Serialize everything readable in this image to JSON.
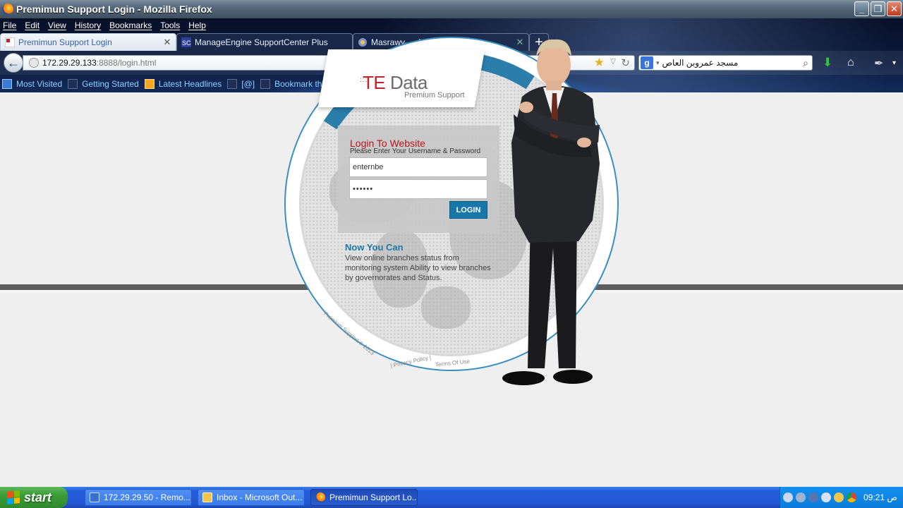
{
  "window": {
    "title": "Premimun Support Login - Mozilla Firefox",
    "controls": [
      "_",
      "❒",
      "✕"
    ]
  },
  "menu": [
    "File",
    "Edit",
    "View",
    "History",
    "Bookmarks",
    "Tools",
    "Help"
  ],
  "tabs": [
    {
      "label": "Premimun Support Login",
      "active": true,
      "close": "✕"
    },
    {
      "label": "ManageEngine SupportCenter Plus",
      "active": false
    },
    {
      "label": "Masrawy-أخبار مصراوي",
      "active": false,
      "close": "✕"
    }
  ],
  "new_tab": "+",
  "navigation": {
    "back": "←",
    "url_host": "172.29.29.133",
    "url_path": ":8888/login.html",
    "star": "★",
    "dropdown": "▽",
    "reload": "↻",
    "search_engine": "g",
    "search_value": "مسجد عمروبن العاص",
    "search_icon": "⌕",
    "download_icon": "⬇",
    "home_icon": "⌂",
    "addon_icon": "✒",
    "menu_drop": "▾"
  },
  "bookmarks": [
    "Most Visited",
    "Getting Started",
    "Latest Headlines",
    "[@]",
    "Bookmark this!"
  ],
  "page": {
    "logo_brand_te": "TE",
    "logo_brand_rest": " Data",
    "logo_dots": ":::",
    "logo_sub": "Premium Support",
    "login_title": "Login To Website",
    "login_subtitle": "Please Enter Your Username & Password",
    "username_value": "enternbe",
    "password_value": "••••••",
    "login_button": "LOGIN",
    "now_title": "Now You Can",
    "now_text": "View online branches status from monitoring system Ability to view branches by governorates and Status.",
    "footer_copyright": "Premium Support © 2013",
    "footer_privacy": "| Privacy Policy |",
    "footer_terms": "Terms Of Use"
  },
  "taskbar": {
    "start_label": "start",
    "tasks": [
      {
        "label": "172.29.29.50 - Remo...",
        "active": false
      },
      {
        "label": "Inbox - Microsoft Out...",
        "active": false
      },
      {
        "label": "Premimun Support Lo...",
        "active": true
      }
    ],
    "clock": "09:21 ص"
  },
  "colors": {
    "brand_red": "#c6202a",
    "accent_blue": "#1677a8",
    "login_title": "#b3151b"
  }
}
